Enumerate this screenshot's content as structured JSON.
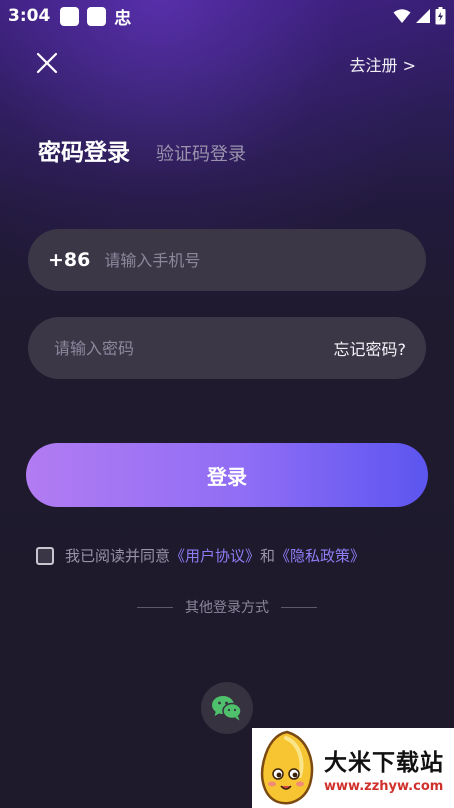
{
  "status_bar": {
    "time": "3:04",
    "app_glyph": "忠",
    "icons": [
      "wifi-icon",
      "signal-icon",
      "battery-icon"
    ]
  },
  "header": {
    "close_icon": "close-icon",
    "register_label": "去注册 >"
  },
  "tabs": {
    "active_label": "密码登录",
    "inactive_label": "验证码登录"
  },
  "phone_field": {
    "country_code": "+86",
    "placeholder": "请输入手机号",
    "value": ""
  },
  "password_field": {
    "placeholder": "请输入密码",
    "value": "",
    "forgot_label": "忘记密码?"
  },
  "login_button": {
    "label": "登录"
  },
  "agreement": {
    "prefix": "我已阅读并同意",
    "user_agreement": "《用户协议》",
    "and": "和",
    "privacy_policy": "《隐私政策》",
    "checked": false
  },
  "other_login": {
    "title": "其他登录方式",
    "methods": [
      "wechat-icon"
    ]
  },
  "watermark": {
    "title": "大米下载站",
    "url": "www.zzhyw.com"
  },
  "colors": {
    "accent_start": "#b27cf2",
    "accent_end": "#5c55f0",
    "link": "#8e7df5",
    "field_bg": "#3b3747",
    "wechat_green": "#4fc06b"
  }
}
